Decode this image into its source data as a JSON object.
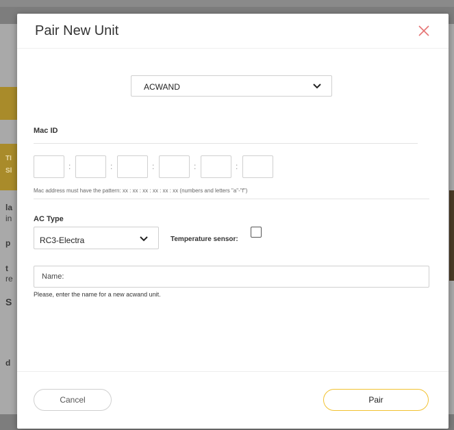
{
  "background": {
    "fragments": [
      "TI",
      "Sl",
      "la",
      "in",
      "p",
      "t",
      "re",
      "S",
      "d"
    ]
  },
  "dialog": {
    "title": "Pair New Unit",
    "device_select": {
      "selected": "ACWAND"
    },
    "mac": {
      "label": "Mac ID",
      "separator": ":",
      "hint": "Mac address must have the pattern: xx : xx : xx : xx : xx : xx (numbers and letters \"a\"-\"f\")"
    },
    "ac_type": {
      "label": "AC Type",
      "selected": "RC3-Electra"
    },
    "temperature_sensor": {
      "label": "Temperature sensor:",
      "checked": false
    },
    "name": {
      "placeholder": "Name:",
      "hint": "Please, enter the name for a new acwand unit."
    },
    "buttons": {
      "cancel": "Cancel",
      "pair": "Pair"
    }
  },
  "colors": {
    "accent": "#f2c12e",
    "close": "#e57373",
    "overlay": "#7d7d7d"
  }
}
